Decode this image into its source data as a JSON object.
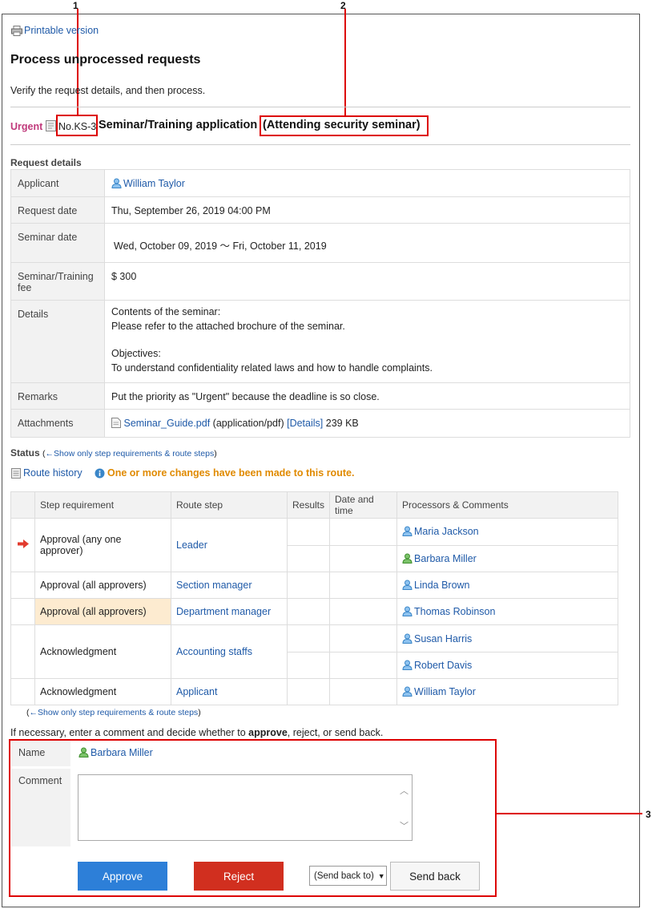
{
  "callouts": [
    "1",
    "2",
    "3"
  ],
  "printable": "Printable version",
  "title": "Process unprocessed requests",
  "subtitle": "Verify the request details, and then process.",
  "request": {
    "priority": "Urgent",
    "number": "No.KS-3",
    "form_name": "Seminar/Training application",
    "subject": "(Attending security seminar)"
  },
  "details": {
    "heading": "Request details",
    "applicant_label": "Applicant",
    "applicant": "William Taylor",
    "request_date_label": "Request date",
    "request_date": "Thu, September 26, 2019 04:00 PM",
    "seminar_date_label": "Seminar date",
    "seminar_date": "Wed, October 09, 2019 ～ Fri, October 11, 2019",
    "fee_label": "Seminar/Training fee",
    "fee": "$ 300",
    "details_label": "Details",
    "details_lines": [
      "Contents of the seminar:",
      "Please refer to the attached brochure of the seminar.",
      "",
      "Objectives:",
      "To understand confidentiality related laws and how to handle complaints."
    ],
    "remarks_label": "Remarks",
    "remarks": "Put the priority as \"Urgent\" because the deadline is so close.",
    "attachments_label": "Attachments",
    "file_name": "Seminar_Guide.pdf",
    "file_type": "(application/pdf)",
    "file_details": "[Details]",
    "file_size": "239 KB"
  },
  "status": {
    "heading": "Status",
    "toggle_open": "(",
    "toggle_link": "←Show only step requirements & route steps",
    "toggle_close": ")",
    "route_history": "Route history",
    "notice": "One or more changes have been made to this route."
  },
  "route_table": {
    "headers": [
      "Step requirement",
      "Route step",
      "Results",
      "Date and time",
      "Processors & Comments"
    ],
    "rows": [
      {
        "requirement": "Approval (any one approver)",
        "step": "Leader",
        "processors": [
          "Maria Jackson",
          "Barbara Miller"
        ]
      },
      {
        "requirement": "Approval (all approvers)",
        "step": "Section manager",
        "processors": [
          "Linda Brown"
        ]
      },
      {
        "requirement": "Approval (all approvers)",
        "step": "Department manager",
        "processors": [
          "Thomas Robinson"
        ]
      },
      {
        "requirement": "Acknowledgment",
        "step": "Accounting staffs",
        "processors": [
          "Susan Harris",
          "Robert Davis"
        ]
      },
      {
        "requirement": "Acknowledgment",
        "step": "Applicant",
        "processors": [
          "William Taylor"
        ]
      }
    ]
  },
  "decision": {
    "instruction_pre": "If necessary, enter a comment and decide whether to ",
    "instruction_bold": "approve",
    "instruction_post": ", reject, or send back.",
    "name_label": "Name",
    "name": "Barbara Miller",
    "comment_label": "Comment",
    "comment_value": "",
    "approve": "Approve",
    "reject": "Reject",
    "send_back_select": "(Send back to)",
    "send_back": "Send back"
  },
  "colors": {
    "urgent": "#c0397b",
    "link": "#1f5aa8",
    "notice": "#e08a00",
    "approve": "#2d7fd8",
    "reject": "#d12f1f",
    "callout": "#dd0000"
  }
}
